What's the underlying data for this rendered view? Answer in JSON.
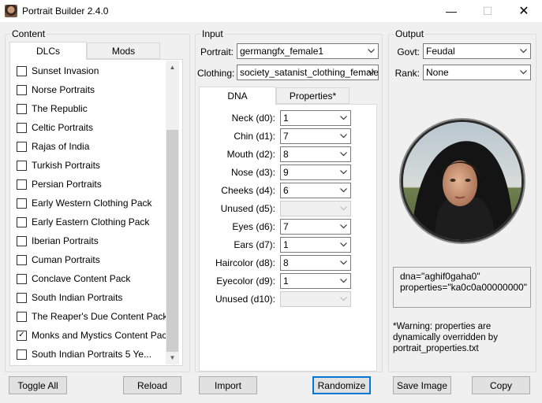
{
  "window": {
    "title": "Portrait Builder 2.4.0",
    "min_glyph": "—",
    "max_glyph": "☐",
    "close_glyph": "✕"
  },
  "content": {
    "group_label": "Content",
    "tabs": [
      "DLCs",
      "Mods"
    ],
    "items": [
      {
        "label": "Sunset Invasion",
        "checked": false
      },
      {
        "label": "Norse Portraits",
        "checked": false
      },
      {
        "label": "The Republic",
        "checked": false
      },
      {
        "label": "Celtic Portraits",
        "checked": false
      },
      {
        "label": "Rajas of India",
        "checked": false
      },
      {
        "label": "Turkish Portraits",
        "checked": false
      },
      {
        "label": "Persian Portraits",
        "checked": false
      },
      {
        "label": "Early Western Clothing Pack",
        "checked": false
      },
      {
        "label": "Early Eastern Clothing Pack",
        "checked": false
      },
      {
        "label": "Iberian Portraits",
        "checked": false
      },
      {
        "label": "Cuman Portraits",
        "checked": false
      },
      {
        "label": "Conclave Content Pack",
        "checked": false
      },
      {
        "label": "South Indian Portraits",
        "checked": false
      },
      {
        "label": "The Reaper's Due Content Pack",
        "checked": false
      },
      {
        "label": "Monks and Mystics Content Pack",
        "checked": true
      },
      {
        "label": "South Indian Portraits 5 Ye...",
        "checked": false
      }
    ],
    "toggle_all": "Toggle All",
    "reload": "Reload"
  },
  "input": {
    "group_label": "Input",
    "portrait_label": "Portrait:",
    "portrait_value": "germangfx_female1",
    "clothing_label": "Clothing:",
    "clothing_value": "society_satanist_clothing_female",
    "tabs": [
      "DNA",
      "Properties*"
    ],
    "dna": [
      {
        "label": "Neck (d0):",
        "value": "1",
        "enabled": true
      },
      {
        "label": "Chin (d1):",
        "value": "7",
        "enabled": true
      },
      {
        "label": "Mouth (d2):",
        "value": "8",
        "enabled": true
      },
      {
        "label": "Nose (d3):",
        "value": "9",
        "enabled": true
      },
      {
        "label": "Cheeks (d4):",
        "value": "6",
        "enabled": true
      },
      {
        "label": "Unused (d5):",
        "value": "",
        "enabled": false
      },
      {
        "label": "Eyes (d6):",
        "value": "7",
        "enabled": true
      },
      {
        "label": "Ears (d7):",
        "value": "1",
        "enabled": true
      },
      {
        "label": "Haircolor (d8):",
        "value": "8",
        "enabled": true
      },
      {
        "label": "Eyecolor (d9):",
        "value": "1",
        "enabled": true
      },
      {
        "label": "Unused (d10):",
        "value": "",
        "enabled": false
      }
    ],
    "import": "Import",
    "randomize": "Randomize"
  },
  "output": {
    "group_label": "Output",
    "govt_label": "Govt:",
    "govt_value": "Feudal",
    "rank_label": "Rank:",
    "rank_value": "None",
    "dna_line": "dna=\"aghif0gaha0\"",
    "properties_line": "properties=\"ka0c0a00000000\"",
    "warning": "*Warning: properties are dynamically overridden by portrait_properties.txt",
    "save_image": "Save Image",
    "copy": "Copy"
  }
}
